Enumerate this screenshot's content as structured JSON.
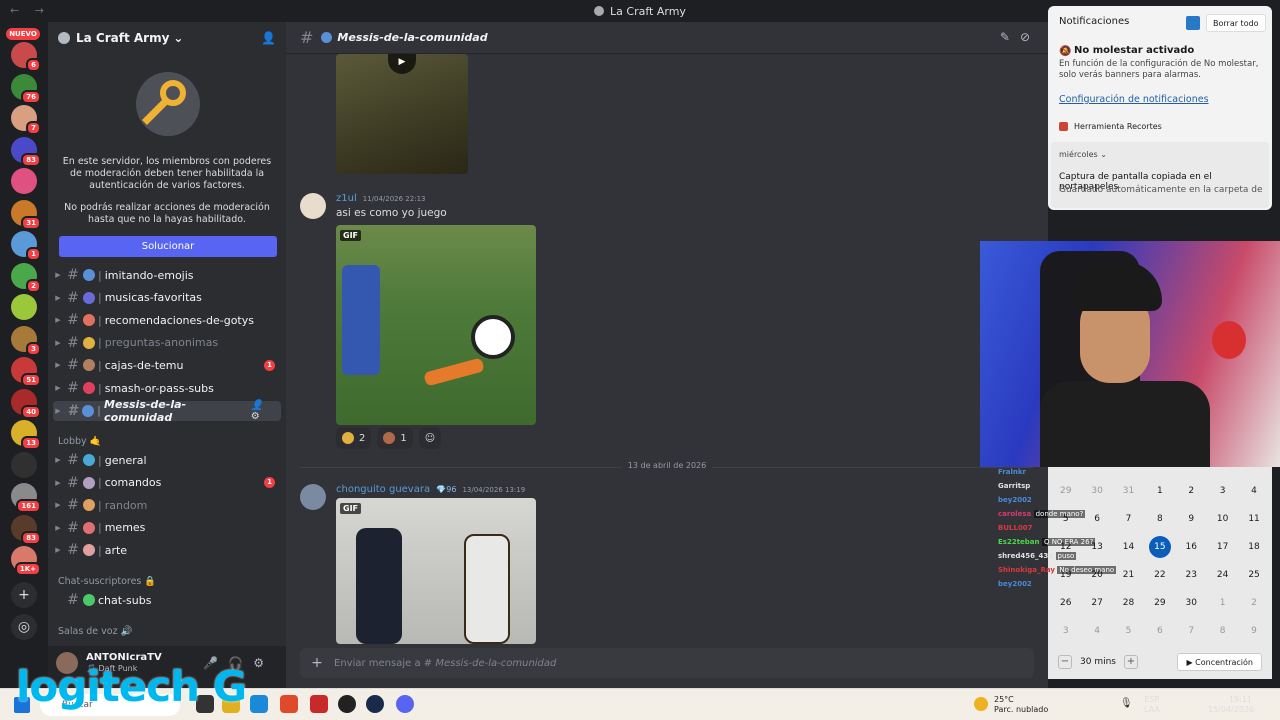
{
  "window": {
    "title": "La Craft Army",
    "nav": "← →"
  },
  "rail": {
    "new_badge": "NUEVO",
    "servers": [
      {
        "badge": "6",
        "color": "#c84a4a"
      },
      {
        "badge": "76",
        "color": "#3a8a3a"
      },
      {
        "badge": "7",
        "color": "#d8a080"
      },
      {
        "badge": "83",
        "color": "#4a4ac8"
      },
      {
        "badge": "",
        "color": "#e05080"
      },
      {
        "badge": "31",
        "color": "#c87a2a"
      },
      {
        "badge": "1",
        "color": "#5a9ad8"
      },
      {
        "badge": "2",
        "color": "#4aa84a"
      },
      {
        "badge": "",
        "color": "#9ac83a"
      },
      {
        "badge": "3",
        "color": "#a87a3a"
      },
      {
        "badge": "51",
        "color": "#c83a3a"
      },
      {
        "badge": "40",
        "color": "#a82a2a"
      },
      {
        "badge": "13",
        "color": "#d8b02a"
      },
      {
        "badge": "",
        "color": "#303030"
      },
      {
        "badge": "161",
        "color": "#8a8a8a"
      },
      {
        "badge": "83",
        "color": "#5a3a2a"
      },
      {
        "badge": "1K+",
        "color": "#d87a6a"
      }
    ]
  },
  "server": {
    "name": "La Craft Army"
  },
  "mod_notice": {
    "text1": "En este servidor, los miembros con poderes de moderación deben tener habilitada la autenticación de varios factores.",
    "text2": "No podrás realizar acciones de moderación hasta que no la hayas habilitado.",
    "button": "Solucionar"
  },
  "channels": [
    {
      "name": "imitando-emojis",
      "emo": "#5b8fd8",
      "muted": false,
      "count": ""
    },
    {
      "name": "musicas-favoritas",
      "emo": "#6a6ad8",
      "muted": false,
      "count": ""
    },
    {
      "name": "recomendaciones-de-gotys",
      "emo": "#e07060",
      "muted": false,
      "count": ""
    },
    {
      "name": "preguntas-anonimas",
      "emo": "#e0b040",
      "muted": true,
      "count": ""
    },
    {
      "name": "cajas-de-temu",
      "emo": "#b08060",
      "muted": false,
      "count": "1"
    },
    {
      "name": "smash-or-pass-subs",
      "emo": "#e04060",
      "muted": false,
      "count": ""
    },
    {
      "name": "Messis-de-la-comunidad",
      "emo": "#5b8fd8",
      "muted": false,
      "count": "",
      "active": true
    }
  ],
  "lobby": {
    "label": "Lobby 🤙",
    "channels": [
      {
        "name": "general",
        "emo": "#4aa8d8",
        "muted": false,
        "count": ""
      },
      {
        "name": "comandos",
        "emo": "#b0a0c0",
        "muted": false,
        "count": "1"
      },
      {
        "name": "random",
        "emo": "#e0a060",
        "muted": true,
        "count": ""
      },
      {
        "name": "memes",
        "emo": "#e07070",
        "muted": false,
        "count": ""
      },
      {
        "name": "arte",
        "emo": "#e0a0a0",
        "muted": false,
        "count": ""
      }
    ]
  },
  "subs": {
    "label": "Chat-suscriptores 🔒",
    "channel": "chat-subs"
  },
  "voice": {
    "label": "Salas de voz 🔊"
  },
  "user": {
    "name": "ANTONIcraTV",
    "status": "🎵 Daft Punk"
  },
  "chat": {
    "channel_title": "Messis-de-la-comunidad",
    "messages": [
      {
        "author": "z1ul",
        "time": "11/04/2026 22:13",
        "text": "asi es como yo juego",
        "gif_label": "GIF"
      },
      {
        "author": "chonguito guevara",
        "badge": "💎96",
        "time": "13/04/2026 13:19",
        "gif_label": "GIF"
      }
    ],
    "reactions": [
      {
        "count": "2"
      },
      {
        "count": "1"
      }
    ],
    "date_separator": "13 de abril de 2026",
    "composer_placeholder": "Enviar mensaje a #",
    "composer_channel": "Messis-de-la-comunidad"
  },
  "notifications": {
    "title": "Notificaciones",
    "clear": "Borrar todo",
    "dnd_title": "No molestar activado",
    "dnd_desc": "En función de la configuración de No molestar, solo verás banners para alarmas.",
    "settings_link": "Configuración de notificaciones",
    "app": "Herramienta Recortes",
    "day": "miércoles",
    "card_title": "Captura de pantalla copiada en el portapapeles",
    "card_desc": "Guardado automáticamente en la carpeta de"
  },
  "calendar": {
    "rows": [
      [
        "29",
        "30",
        "31",
        "1",
        "2",
        "3",
        "4"
      ],
      [
        "5",
        "6",
        "7",
        "8",
        "9",
        "10",
        "11"
      ],
      [
        "12",
        "13",
        "14",
        "15",
        "16",
        "17",
        "18"
      ],
      [
        "19",
        "20",
        "21",
        "22",
        "23",
        "24",
        "25"
      ],
      [
        "26",
        "27",
        "28",
        "29",
        "30",
        "1",
        "2"
      ],
      [
        "3",
        "4",
        "5",
        "6",
        "7",
        "8",
        "9"
      ]
    ],
    "today": "15",
    "focus_minutes": "30 mins",
    "focus_label": "Concentración"
  },
  "stream_chat": [
    {
      "user": "Fralnkr",
      "color": "#4a8ad8",
      "msg": ""
    },
    {
      "user": "Garritsp",
      "color": "#e0e0e0",
      "msg": ""
    },
    {
      "user": "bey2002",
      "color": "#4a8ad8",
      "msg": ""
    },
    {
      "user": "carolesa",
      "color": "#d83a6a",
      "msg": "donde mano?"
    },
    {
      "user": "BULL007",
      "color": "#d83a3a",
      "msg": ""
    },
    {
      "user": "Es22teban",
      "color": "#4ad84a",
      "msg": "Q NO ERA 26?"
    },
    {
      "user": "shred456_431",
      "color": "#e0e0e0",
      "msg": "puso"
    },
    {
      "user": "Shinokiga_Ray",
      "color": "#d83a3a",
      "msg": "No deseo mano"
    },
    {
      "user": "bey2002",
      "color": "#4a8ad8",
      "msg": ""
    }
  ],
  "taskbar": {
    "search": "Buscar",
    "weather_temp": "25°C",
    "weather_desc": "Parc. nublado",
    "lang1": "ESP",
    "lang2": "LAA",
    "time": "19:11",
    "date": "15/04/2026"
  },
  "overlay": {
    "logo_text": "logitech G"
  }
}
